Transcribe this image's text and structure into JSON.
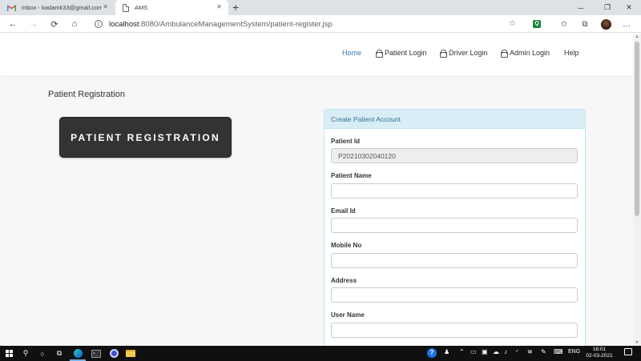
{
  "browser": {
    "tabs": [
      {
        "title": "Inbox - kadamk33@gmail.com -",
        "active": false,
        "icon": "gmail-icon"
      },
      {
        "title": "AMS",
        "active": true,
        "icon": "document-icon"
      }
    ],
    "close_glyph": "✕",
    "new_tab_glyph": "+",
    "window_controls": {
      "minimize": "─",
      "restore": "❐",
      "close": "✕"
    },
    "nav": {
      "back": "←",
      "forward": "→",
      "reload": "⟳",
      "home": "⌂"
    },
    "url_host": "localhost",
    "url_rest": ":8080/AmbulanceManagementSystem/patient-register.jsp",
    "info_glyph": "i",
    "toolbar_glyphs": {
      "favorite": "☆",
      "extension": "Q",
      "favorites": "✩",
      "collections": "⧉"
    }
  },
  "site": {
    "nav": {
      "home": "Home",
      "patient_login": "Patient Login",
      "driver_login": "Driver Login",
      "admin_login": "Admin Login",
      "help": "Help"
    },
    "page_heading": "Patient Registration",
    "badge_text": "PATIENT REGISTRATION",
    "accent_color": "#337ab7"
  },
  "form": {
    "panel_title": "Create Patient Account",
    "fields": [
      {
        "label": "Patient Id",
        "value": "P20210302040120",
        "readonly": true
      },
      {
        "label": "Patient Name",
        "value": ""
      },
      {
        "label": "Email Id",
        "value": ""
      },
      {
        "label": "Mobile No",
        "value": ""
      },
      {
        "label": "Address",
        "value": ""
      },
      {
        "label": "User Name",
        "value": ""
      }
    ]
  },
  "taskbar": {
    "search_glyph": "⚲",
    "task_view_glyph": "○",
    "tray": {
      "help": "?",
      "language": "ENG"
    },
    "time": "16:01",
    "date": "02-03-2021"
  }
}
